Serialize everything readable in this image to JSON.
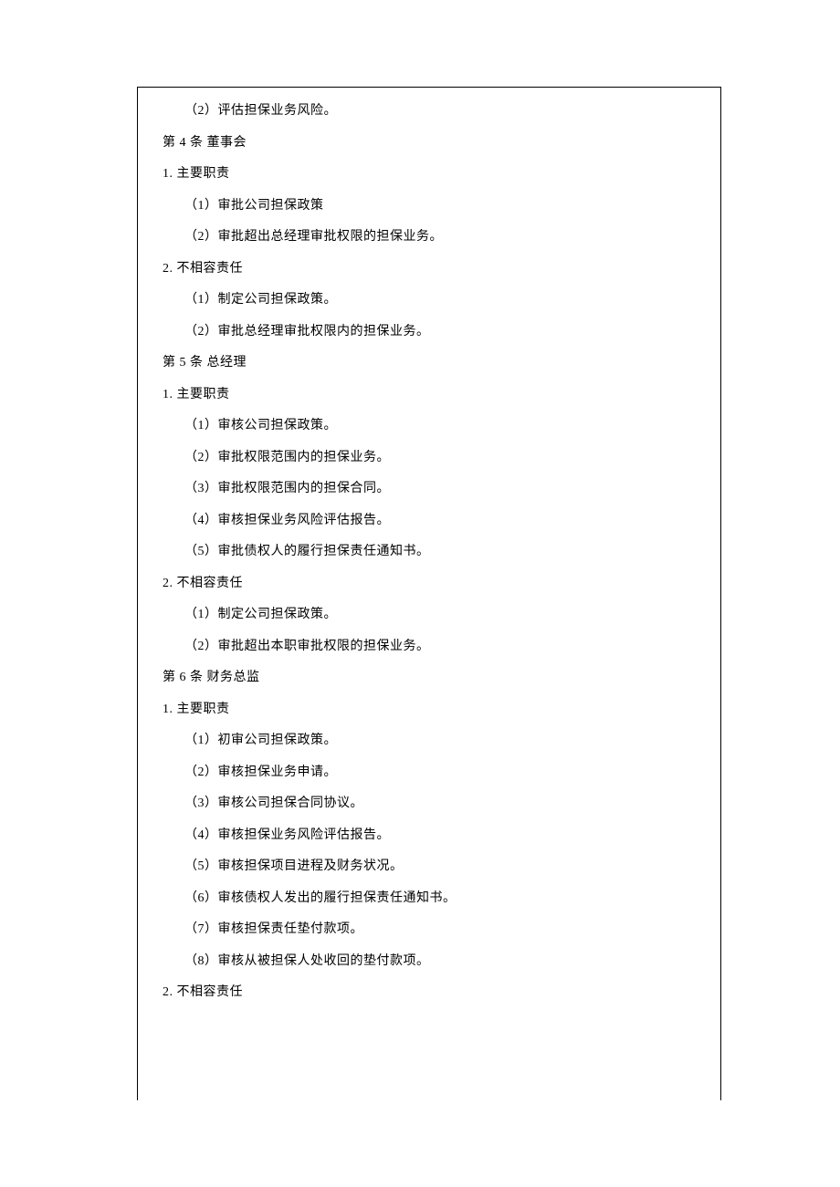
{
  "lines": [
    {
      "indent": 1,
      "text": "（2）评估担保业务风险。"
    },
    {
      "indent": 0,
      "text": "第 4 条 董事会"
    },
    {
      "indent": 0,
      "text": "1. 主要职责"
    },
    {
      "indent": 1,
      "text": "（1）审批公司担保政策"
    },
    {
      "indent": 1,
      "text": "（2）审批超出总经理审批权限的担保业务。"
    },
    {
      "indent": 0,
      "text": "2. 不相容责任"
    },
    {
      "indent": 1,
      "text": "（1）制定公司担保政策。"
    },
    {
      "indent": 1,
      "text": "（2）审批总经理审批权限内的担保业务。"
    },
    {
      "indent": 0,
      "text": "第 5 条 总经理"
    },
    {
      "indent": 0,
      "text": "1. 主要职责"
    },
    {
      "indent": 1,
      "text": "（1）审核公司担保政策。"
    },
    {
      "indent": 1,
      "text": "（2）审批权限范围内的担保业务。"
    },
    {
      "indent": 1,
      "text": "（3）审批权限范围内的担保合同。"
    },
    {
      "indent": 1,
      "text": "（4）审核担保业务风险评估报告。"
    },
    {
      "indent": 1,
      "text": "（5）审批债权人的履行担保责任通知书。"
    },
    {
      "indent": 0,
      "text": "2. 不相容责任"
    },
    {
      "indent": 1,
      "text": "（1）制定公司担保政策。"
    },
    {
      "indent": 1,
      "text": "（2）审批超出本职审批权限的担保业务。"
    },
    {
      "indent": 0,
      "text": "第 6 条 财务总监"
    },
    {
      "indent": 0,
      "text": "1. 主要职责"
    },
    {
      "indent": 1,
      "text": "（1）初审公司担保政策。"
    },
    {
      "indent": 1,
      "text": "（2）审核担保业务申请。"
    },
    {
      "indent": 1,
      "text": "（3）审核公司担保合同协议。"
    },
    {
      "indent": 1,
      "text": "（4）审核担保业务风险评估报告。"
    },
    {
      "indent": 1,
      "text": "（5）审核担保项目进程及财务状况。"
    },
    {
      "indent": 1,
      "text": "（6）审核债权人发出的履行担保责任通知书。"
    },
    {
      "indent": 1,
      "text": "（7）审核担保责任垫付款项。"
    },
    {
      "indent": 1,
      "text": "（8）审核从被担保人处收回的垫付款项。"
    },
    {
      "indent": 0,
      "text": "2. 不相容责任"
    }
  ]
}
